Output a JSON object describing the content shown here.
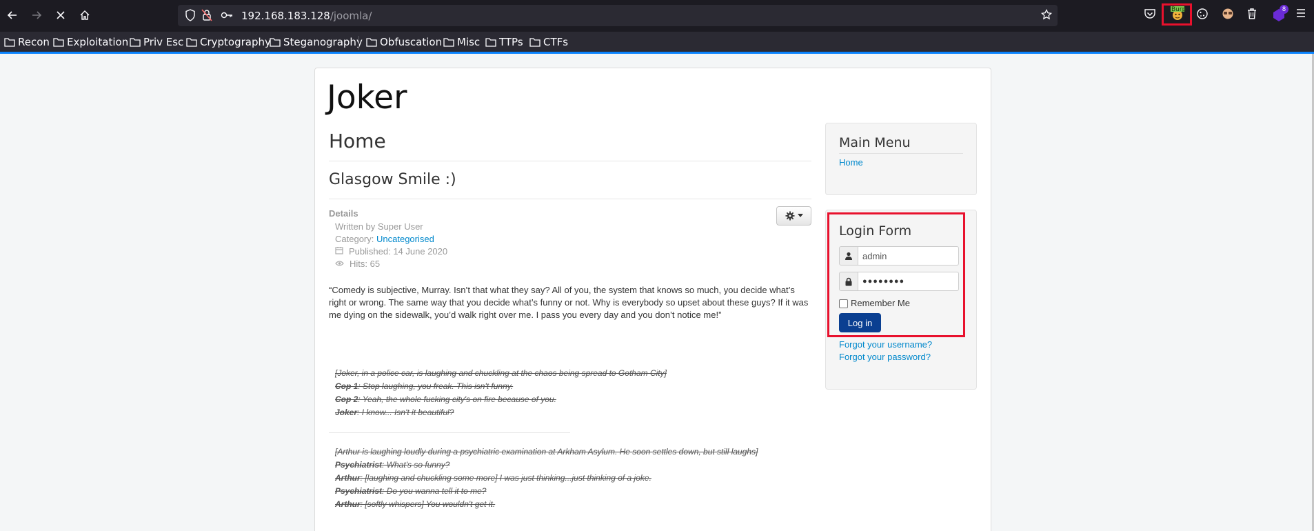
{
  "browser": {
    "url_host": "192.168.183.128",
    "url_path": "/joomla/",
    "bookmarks": [
      "Recon",
      "Exploitation",
      "Priv Esc",
      "Cryptography",
      "Steganography",
      "Obfuscation",
      "Misc",
      "TTPs",
      "CTFs"
    ],
    "extensions": {
      "burp_label": "Burp",
      "badge_count": "8"
    }
  },
  "site": {
    "brand": "Joker",
    "page_heading": "Home",
    "article": {
      "title": "Glasgow Smile :)",
      "details_label": "Details",
      "written_by": "Written by Super User",
      "category_prefix": "Category: ",
      "category": "Uncategorised",
      "published": "Published: 14 June 2020",
      "hits": "Hits: 65",
      "quote": "“Comedy is subjective, Murray. Isn’t that what they say? All of you, the system that knows so much, you decide what’s right or wrong. The same way that you decide what’s funny or not. Why is everybody so upset about these guys? If it was me dying on the sidewalk, you’d walk right over me. I pass you every day and you don’t notice me!”",
      "dialog1": [
        {
          "speaker": "",
          "line": "[Joker, in a police car, is laughing and chuckling at the chaos being spread to Gotham City]"
        },
        {
          "speaker": "Cop 1",
          "line": ": Stop laughing, you freak. This isn't funny."
        },
        {
          "speaker": "Cop 2",
          "line": ": Yeah, the whole fucking city's on fire because of you."
        },
        {
          "speaker": "Joker",
          "line": ": I know... Isn't it beautiful?"
        }
      ],
      "dialog2": [
        {
          "speaker": "",
          "line": "[Arthur is laughing loudly during a psychiatric examination at Arkham Asylum. He soon settles down, but still laughs]"
        },
        {
          "speaker": "Psychiatrist",
          "line": ": What's so funny?"
        },
        {
          "speaker": "Arthur",
          "line": ": [laughing and chuckling some more] I was just thinking...just thinking of a joke."
        },
        {
          "speaker": "Psychiatrist",
          "line": ": Do you wanna tell it to me?"
        },
        {
          "speaker": "Arthur",
          "line": ": [softly whispers] You wouldn't get it."
        }
      ]
    }
  },
  "sidebar": {
    "main_menu": {
      "title": "Main Menu",
      "home_link": "Home"
    },
    "login": {
      "title": "Login Form",
      "username_value": "admin",
      "password_value": "●●●●●●●●",
      "remember_label": "Remember Me",
      "login_button": "Log in",
      "forgot_username": "Forgot your username?",
      "forgot_password": "Forgot your password?"
    }
  },
  "colors": {
    "highlight": "#e8112d",
    "link": "#0088cc",
    "login_button": "#0a3f91",
    "chrome": "#1c1b22"
  }
}
